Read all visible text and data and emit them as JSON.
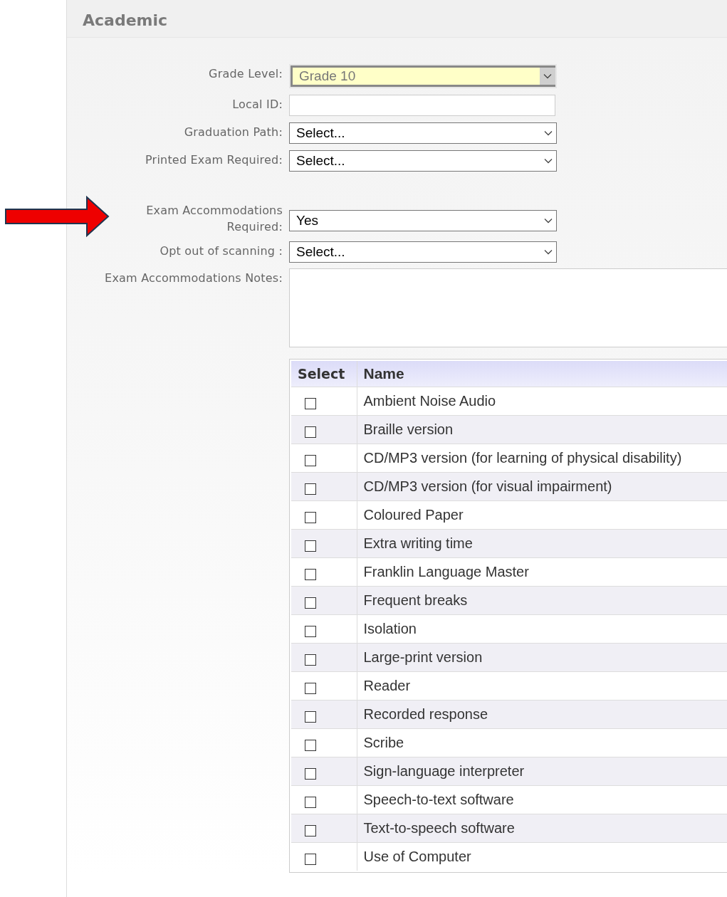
{
  "section": {
    "title": "Academic"
  },
  "fields": [
    {
      "kind": "select",
      "label": "Grade Level:",
      "value": "Grade 10",
      "disabled": true,
      "highlighted": true
    },
    {
      "kind": "text",
      "label": "Local ID:"
    },
    {
      "kind": "select",
      "label": "Graduation Path:",
      "value": "Select...",
      "disabled": false
    },
    {
      "kind": "select",
      "label": "Printed Exam Required:",
      "value": "Select...",
      "disabled": false
    },
    {
      "kind": "gap"
    },
    {
      "kind": "select",
      "label": "Exam Accommodations Required:",
      "value": "Yes",
      "disabled": false,
      "pointer": true
    },
    {
      "kind": "select",
      "label": "Opt out of scanning :",
      "value": "Select...",
      "disabled": false
    },
    {
      "kind": "textarea",
      "label": "Exam Accommodations Notes:"
    }
  ],
  "table": {
    "columns": [
      "Select",
      "Name"
    ],
    "rows": [
      {
        "name": "Ambient Noise Audio",
        "checked": false
      },
      {
        "name": "Braille version",
        "checked": false
      },
      {
        "name": "CD/MP3 version (for learning of physical disability)",
        "checked": false
      },
      {
        "name": "CD/MP3 version (for visual impairment)",
        "checked": false
      },
      {
        "name": "Coloured Paper",
        "checked": false
      },
      {
        "name": "Extra writing time",
        "checked": false
      },
      {
        "name": "Franklin Language Master",
        "checked": false
      },
      {
        "name": "Frequent breaks",
        "checked": false
      },
      {
        "name": "Isolation",
        "checked": false
      },
      {
        "name": "Large-print version",
        "checked": false
      },
      {
        "name": "Reader",
        "checked": false
      },
      {
        "name": "Recorded response",
        "checked": false
      },
      {
        "name": "Scribe",
        "checked": false
      },
      {
        "name": "Sign-language interpreter",
        "checked": false
      },
      {
        "name": "Speech-to-text software",
        "checked": false
      },
      {
        "name": "Text-to-speech software",
        "checked": false
      },
      {
        "name": "Use of Computer",
        "checked": false
      }
    ]
  }
}
